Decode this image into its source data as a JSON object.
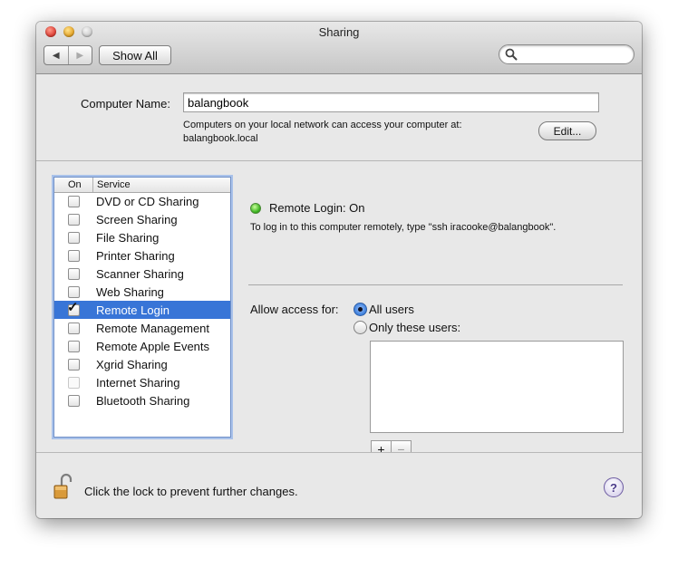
{
  "window": {
    "title": "Sharing"
  },
  "toolbar": {
    "back_glyph": "◀",
    "forward_glyph": "▶",
    "show_all_label": "Show All",
    "search_placeholder": "",
    "search_value": ""
  },
  "computer_name": {
    "label": "Computer Name:",
    "value": "balangbook",
    "info_line1": "Computers on your local network can access your computer at:",
    "info_line2": "balangbook.local",
    "edit_label": "Edit..."
  },
  "services": {
    "header_on": "On",
    "header_service": "Service",
    "items": [
      {
        "label": "DVD or CD Sharing",
        "checked": false,
        "selected": false
      },
      {
        "label": "Screen Sharing",
        "checked": false,
        "selected": false
      },
      {
        "label": "File Sharing",
        "checked": false,
        "selected": false
      },
      {
        "label": "Printer Sharing",
        "checked": false,
        "selected": false
      },
      {
        "label": "Scanner Sharing",
        "checked": false,
        "selected": false
      },
      {
        "label": "Web Sharing",
        "checked": false,
        "selected": false
      },
      {
        "label": "Remote Login",
        "checked": true,
        "selected": true
      },
      {
        "label": "Remote Management",
        "checked": false,
        "selected": false
      },
      {
        "label": "Remote Apple Events",
        "checked": false,
        "selected": false
      },
      {
        "label": "Xgrid Sharing",
        "checked": false,
        "selected": false
      },
      {
        "label": "Internet Sharing",
        "checked": false,
        "selected": false
      },
      {
        "label": "Bluetooth Sharing",
        "checked": false,
        "selected": false
      }
    ]
  },
  "detail": {
    "status_title": "Remote Login: On",
    "status_color": "#39b21e",
    "description": "To log in to this computer remotely, type \"ssh iracooke@balangbook\".",
    "allow_label": "Allow access for:",
    "option_all": "All users",
    "option_only": "Only these users:",
    "selected_option": "all",
    "add_glyph": "+",
    "remove_glyph": "−"
  },
  "footer": {
    "lock_text": "Click the lock to prevent further changes.",
    "help_glyph": "?"
  },
  "colors": {
    "selection": "#3875d7",
    "list_focus": "#a9c2ea"
  }
}
